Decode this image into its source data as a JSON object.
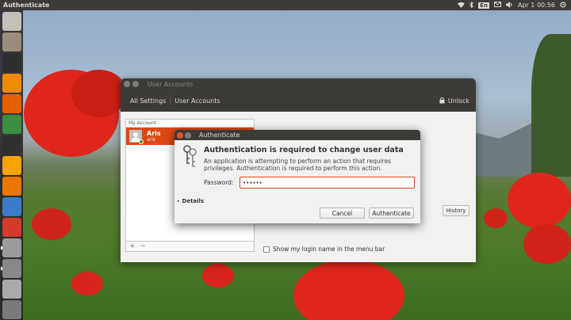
{
  "top_panel": {
    "app_title": "Authenticate",
    "keyboard_layout": "En",
    "clock": "Apr 1 00:56"
  },
  "launcher": {
    "items": [
      {
        "icon": "dash-home-icon",
        "color": "#c4c0b7"
      },
      {
        "icon": "files-icon",
        "color": "#9a8c7b"
      },
      {
        "icon": "terminal-icon",
        "color": "#2e2e2e"
      },
      {
        "icon": "vlc-icon",
        "color": "#f08a00"
      },
      {
        "icon": "firefox-icon",
        "color": "#e66000"
      },
      {
        "icon": "chrome-icon",
        "color": "#3b8f3f"
      },
      {
        "icon": "kdenlive-icon",
        "color": "#303030"
      },
      {
        "icon": "audacity-icon",
        "color": "#f5a300"
      },
      {
        "icon": "blender-icon",
        "color": "#ea7600"
      },
      {
        "icon": "libreoffice-writer-icon",
        "color": "#3b7bc8"
      },
      {
        "icon": "system-settings-icon",
        "color": "#d63a2d"
      },
      {
        "icon": "user-accounts-icon",
        "color": "#9b9b9b"
      },
      {
        "icon": "authenticate-icon",
        "color": "#888888"
      },
      {
        "icon": "drive-icon",
        "color": "#a9a9a9"
      },
      {
        "icon": "trash-icon",
        "color": "#7a7a7a"
      }
    ]
  },
  "user_accounts": {
    "window_title": "User Accounts",
    "toolbar": {
      "all_settings": "All Settings",
      "current_page": "User Accounts",
      "unlock": "Unlock"
    },
    "list_header": "My Account",
    "user": {
      "name": "Aris",
      "username": "aris"
    },
    "add_label": "+",
    "remove_label": "−",
    "history_button": "History",
    "login_option": "Show my login name in the menu bar"
  },
  "auth_dialog": {
    "title": "Authenticate",
    "heading": "Authentication is required to change user data",
    "description": "An application is attempting to perform an action that requires privileges. Authentication is required to perform this action.",
    "password_label": "Password:",
    "password_value": "••••••",
    "details_label": "Details",
    "cancel_button": "Cancel",
    "authenticate_button": "Authenticate"
  }
}
